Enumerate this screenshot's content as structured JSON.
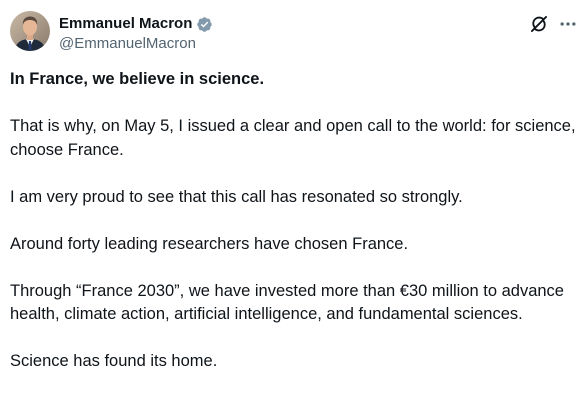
{
  "author": {
    "display_name": "Emmanuel Macron",
    "handle": "@EmmanuelMacron",
    "verified": true,
    "verified_icon": "verified-badge-icon",
    "verified_color": "#829aab"
  },
  "actions": {
    "grok_icon": "grok-icon",
    "more_icon": "more-options-icon"
  },
  "tweet": {
    "paragraphs": [
      "In France, we believe in science.",
      "That is why, on May 5, I issued a clear and open call to the world: for science, choose France.",
      "I am very proud to see that this call has resonated so strongly.",
      "Around forty leading researchers have chosen France.",
      "Through “France 2030”, we have invested more than €30 million to advance health, climate action, artificial intelligence, and fundamental sciences.",
      "Science has found its home."
    ]
  },
  "colors": {
    "text_primary": "#0f1419",
    "text_secondary": "#536471",
    "background": "#ffffff"
  }
}
